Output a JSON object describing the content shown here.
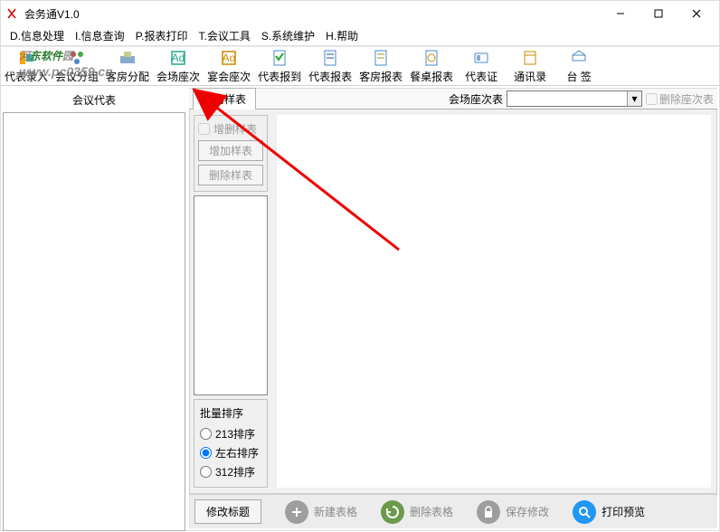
{
  "title": "会务通V1.0",
  "menu": [
    "D.信息处理",
    "I.信息查询",
    "P.报表打印",
    "T.会议工具",
    "S.系统维护",
    "H.帮助"
  ],
  "toolbar": [
    {
      "label": "代表录入"
    },
    {
      "label": "会议分组"
    },
    {
      "label": "客房分配"
    },
    {
      "label": "会场座次"
    },
    {
      "label": "宴会座次"
    },
    {
      "label": "代表报到"
    },
    {
      "label": "代表报表"
    },
    {
      "label": "客房报表"
    },
    {
      "label": "餐桌报表"
    },
    {
      "label": "代表证"
    },
    {
      "label": "通讯录"
    },
    {
      "label": "台  签"
    }
  ],
  "leftPanelTitle": "会议代表",
  "tabLabel": "会场样表",
  "seatLabel": "会场座次表",
  "deleteSeatLabel": "删除座次表",
  "sampleGroup": {
    "checkbox": "增删样表",
    "addBtn": "增加样表",
    "delBtn": "删除样表"
  },
  "sortGroup": {
    "title": "批量排序",
    "opt1": "213排序",
    "opt2": "左右排序",
    "opt3": "312排序"
  },
  "bottom": {
    "modifyTitle": "修改标题",
    "newTable": "新建表格",
    "delTable": "删除表格",
    "saveEdit": "保存修改",
    "printPreview": "打印预览"
  },
  "watermark": {
    "pre": "河",
    "mid": "东软件",
    "suf": "园",
    "url": "www.pc0359.cn"
  }
}
